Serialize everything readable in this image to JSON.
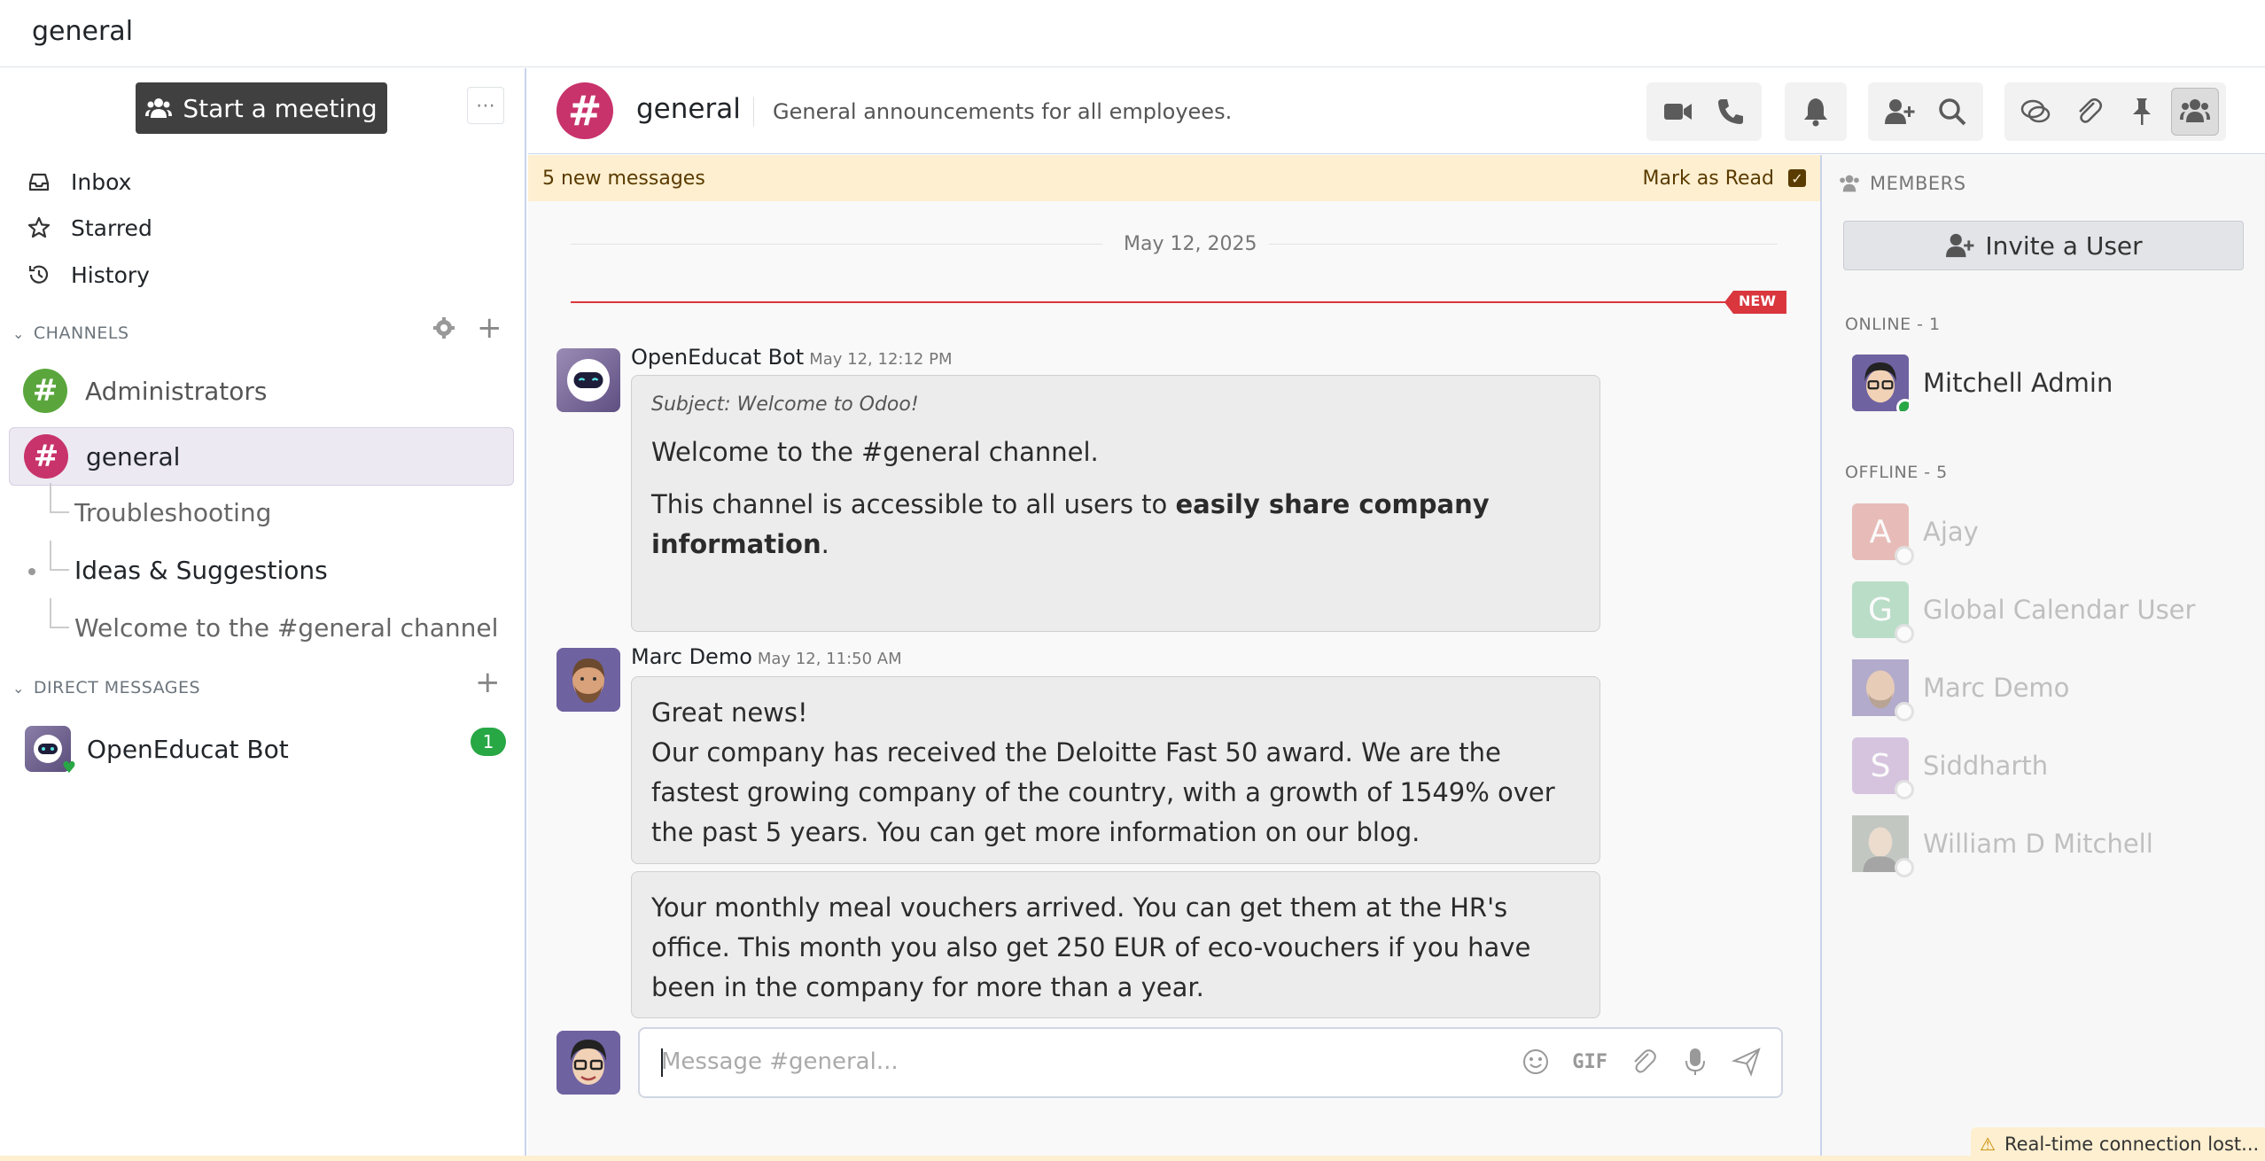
{
  "topbar": {
    "title": "general"
  },
  "sidebar": {
    "meeting_label": "Start a meeting",
    "nav": [
      {
        "label": "Inbox",
        "icon": "inbox-icon"
      },
      {
        "label": "Starred",
        "icon": "star-icon"
      },
      {
        "label": "History",
        "icon": "history-icon"
      }
    ],
    "channels_header": "CHANNELS",
    "channels": [
      {
        "label": "Administrators",
        "color": "#5aa63c"
      },
      {
        "label": "general",
        "color": "#c8336b"
      }
    ],
    "subthreads": [
      "Troubleshooting",
      "Ideas & Suggestions",
      "Welcome to the #general channel"
    ],
    "dm_header": "DIRECT MESSAGES",
    "dms": [
      {
        "label": "OpenEducat Bot",
        "unread": "1"
      }
    ]
  },
  "header": {
    "name": "general",
    "description": "General announcements for all employees.",
    "avatar_symbol": "#"
  },
  "newbar": {
    "text": "5 new messages",
    "mark_label": "Mark as Read"
  },
  "thread": {
    "date": "May 12, 2025",
    "new_tag": "NEW",
    "messages": [
      {
        "author": "OpenEducat Bot",
        "time": "May 12, 12:12 PM",
        "subject": "Subject: Welcome to Odoo!",
        "p1": "Welcome to the #general channel.",
        "p2_start": "This channel is accessible to all users to ",
        "p2_bold": "easily share company information",
        "p2_end": "."
      },
      {
        "author": "Marc Demo",
        "time": "May 12, 11:50 AM",
        "line1": "Great news!",
        "line2": "Our company has received the Deloitte Fast 50 award. We are the fastest growing company of the country, with a growth of 1549% over the past 5 years. You can get more information on our blog.",
        "line3": "Your monthly meal vouchers arrived. You can get them at the HR's office. This month you also get 250 EUR of eco-vouchers if you have been in the company for more than a year."
      }
    ]
  },
  "composer": {
    "placeholder": "Message #general...",
    "gif_label": "GIF"
  },
  "members": {
    "header": "MEMBERS",
    "invite_label": "Invite a User",
    "online_label": "ONLINE - 1",
    "offline_label": "OFFLINE - 5",
    "online": [
      {
        "name": "Mitchell Admin"
      }
    ],
    "offline": [
      {
        "name": "Ajay",
        "initial": "A",
        "color": "#d9837b"
      },
      {
        "name": "Global Calendar User",
        "initial": "G",
        "color": "#7fc59b"
      },
      {
        "name": "Marc Demo",
        "initial": "",
        "color": "#a89ac5"
      },
      {
        "name": "Siddharth",
        "initial": "S",
        "color": "#b793c9"
      },
      {
        "name": "William D Mitchell",
        "initial": "",
        "color": "#9aa39a"
      }
    ]
  },
  "toast": {
    "text": "Real-time connection lost..."
  }
}
